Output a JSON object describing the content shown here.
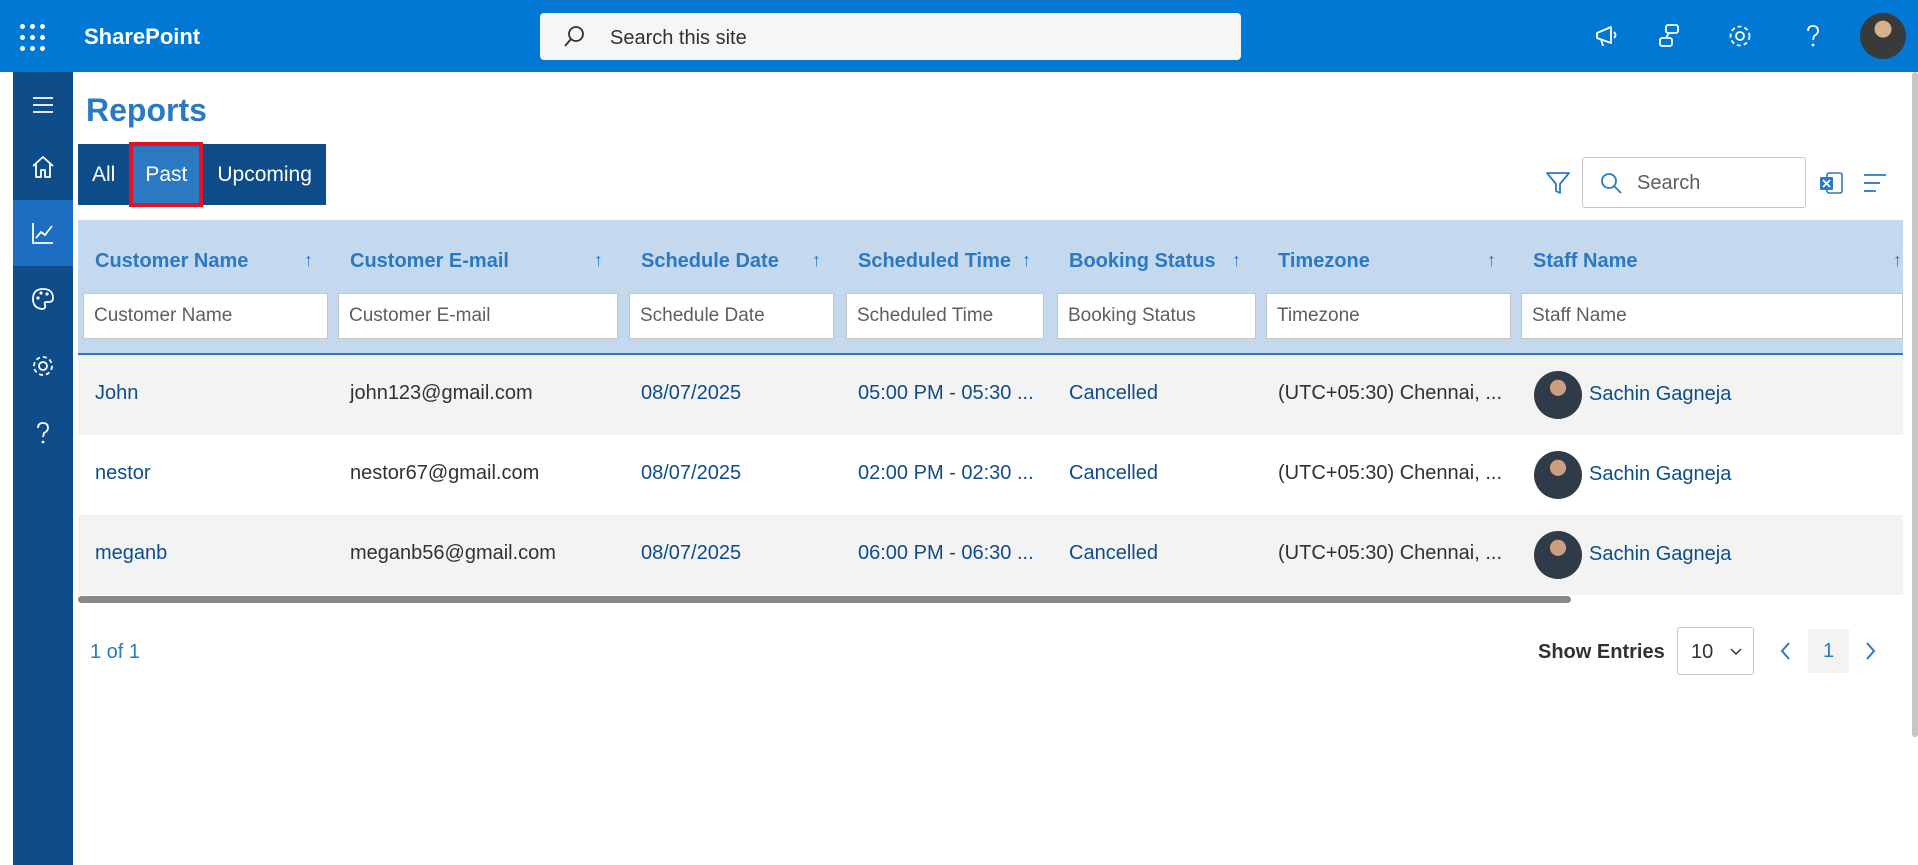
{
  "app": {
    "brand": "SharePoint",
    "site_search_placeholder": "Search this site"
  },
  "page": {
    "title": "Reports",
    "tabs": [
      {
        "label": "All",
        "active": false
      },
      {
        "label": "Past",
        "active": true
      },
      {
        "label": "Upcoming",
        "active": false
      }
    ],
    "table_search_placeholder": "Search"
  },
  "table": {
    "columns": [
      {
        "label": "Customer Name",
        "filter_placeholder": "Customer Name"
      },
      {
        "label": "Customer E-mail",
        "filter_placeholder": "Customer E-mail"
      },
      {
        "label": "Schedule Date",
        "filter_placeholder": "Schedule Date"
      },
      {
        "label": "Scheduled Time",
        "filter_placeholder": "Scheduled Time"
      },
      {
        "label": "Booking Status",
        "filter_placeholder": "Booking Status"
      },
      {
        "label": "Timezone",
        "filter_placeholder": "Timezone"
      },
      {
        "label": "Staff Name",
        "filter_placeholder": "Staff Name"
      }
    ],
    "sort_icon": "↑",
    "rows": [
      {
        "customer_name": "John",
        "email": "john123@gmail.com",
        "date": "08/07/2025",
        "time": "05:00 PM - 05:30 ...",
        "status": "Cancelled",
        "timezone": "(UTC+05:30) Chennai, ...",
        "staff": "Sachin Gagneja"
      },
      {
        "customer_name": "nestor",
        "email": "nestor67@gmail.com",
        "date": "08/07/2025",
        "time": "02:00 PM - 02:30 ...",
        "status": "Cancelled",
        "timezone": "(UTC+05:30) Chennai, ...",
        "staff": "Sachin Gagneja"
      },
      {
        "customer_name": "meganb",
        "email": "meganb56@gmail.com",
        "date": "08/07/2025",
        "time": "06:00 PM - 06:30 ...",
        "status": "Cancelled",
        "timezone": "(UTC+05:30) Chennai, ...",
        "staff": "Sachin Gagneja"
      }
    ]
  },
  "pagination": {
    "summary": "1 of 1",
    "show_entries_label": "Show Entries",
    "entries_value": "10",
    "current_page": "1"
  },
  "colors": {
    "suite_bar": "#0078d4",
    "rail": "#0f4c8a",
    "accent": "#2b79c2",
    "header_bg": "#c4d9ee",
    "highlight": "#e81123"
  }
}
